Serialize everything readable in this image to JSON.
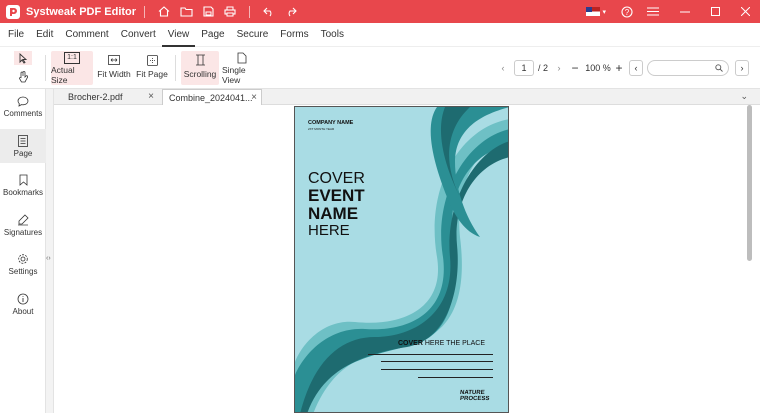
{
  "app": {
    "title": "Systweak PDF Editor"
  },
  "menu": [
    "File",
    "Edit",
    "Comment",
    "Convert",
    "View",
    "Page",
    "Secure",
    "Forms",
    "Tools"
  ],
  "menu_active": "View",
  "toolbar": {
    "actual_size_label": "Actual Size",
    "actual_size_icon_text": "1:1",
    "fit_width_label": "Fit Width",
    "fit_page_label": "Fit Page",
    "scrolling_label": "Scrolling",
    "single_view_label": "Single View",
    "page_current": "1",
    "page_total": "/ 2",
    "zoom": "100 %",
    "search_placeholder": ""
  },
  "sidebar": {
    "items": [
      {
        "label": "Comments",
        "icon": "comment-icon"
      },
      {
        "label": "Page",
        "icon": "page-icon"
      },
      {
        "label": "Bookmarks",
        "icon": "bookmark-icon"
      },
      {
        "label": "Signatures",
        "icon": "signature-icon"
      },
      {
        "label": "Settings",
        "icon": "gear-icon"
      },
      {
        "label": "About",
        "icon": "info-icon"
      }
    ]
  },
  "tabs": [
    {
      "label": "Brocher-2.pdf"
    },
    {
      "label": "Combine_2024041..."
    }
  ],
  "document": {
    "company": "COMPANY NAME",
    "tagline": "2XT MONTH YEAR",
    "cover": "COVER",
    "event": "EVENT",
    "name": "NAME",
    "here": "HERE",
    "cover_bold": "COVER",
    "cover_rest": "HERE THE PLACE",
    "logo_line1": "NATURE",
    "logo_line2": "PROCESS"
  },
  "colors": {
    "titlebar": "#e8474c",
    "accent": "#e8474c",
    "page_bg": "#a9dce4",
    "wave_dark": "#1e6b70",
    "wave_mid": "#2b8f94",
    "wave_light": "#6ec0c5"
  }
}
